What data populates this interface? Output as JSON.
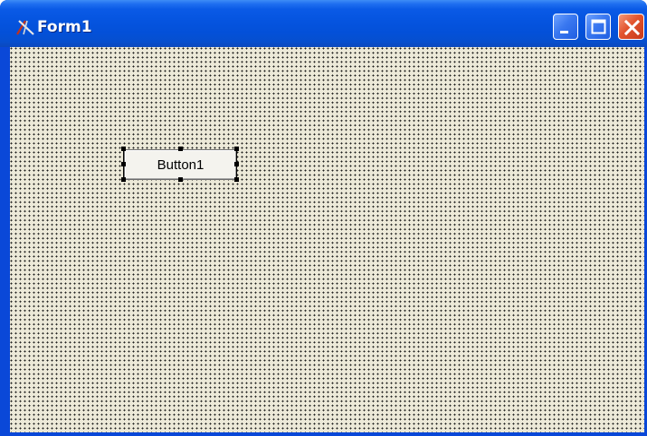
{
  "window": {
    "title": "Form1",
    "app_icon": "lazarus-icon",
    "controls": {
      "minimize": "minimize-icon",
      "maximize": "maximize-icon",
      "close": "close-icon"
    }
  },
  "form": {
    "grid": "dotted",
    "components": [
      {
        "type": "button",
        "caption": "Button1",
        "selected": true
      }
    ]
  },
  "colors": {
    "titlebar": "#0554df",
    "form_background": "#ece9d8",
    "close_button": "#e2542e"
  }
}
